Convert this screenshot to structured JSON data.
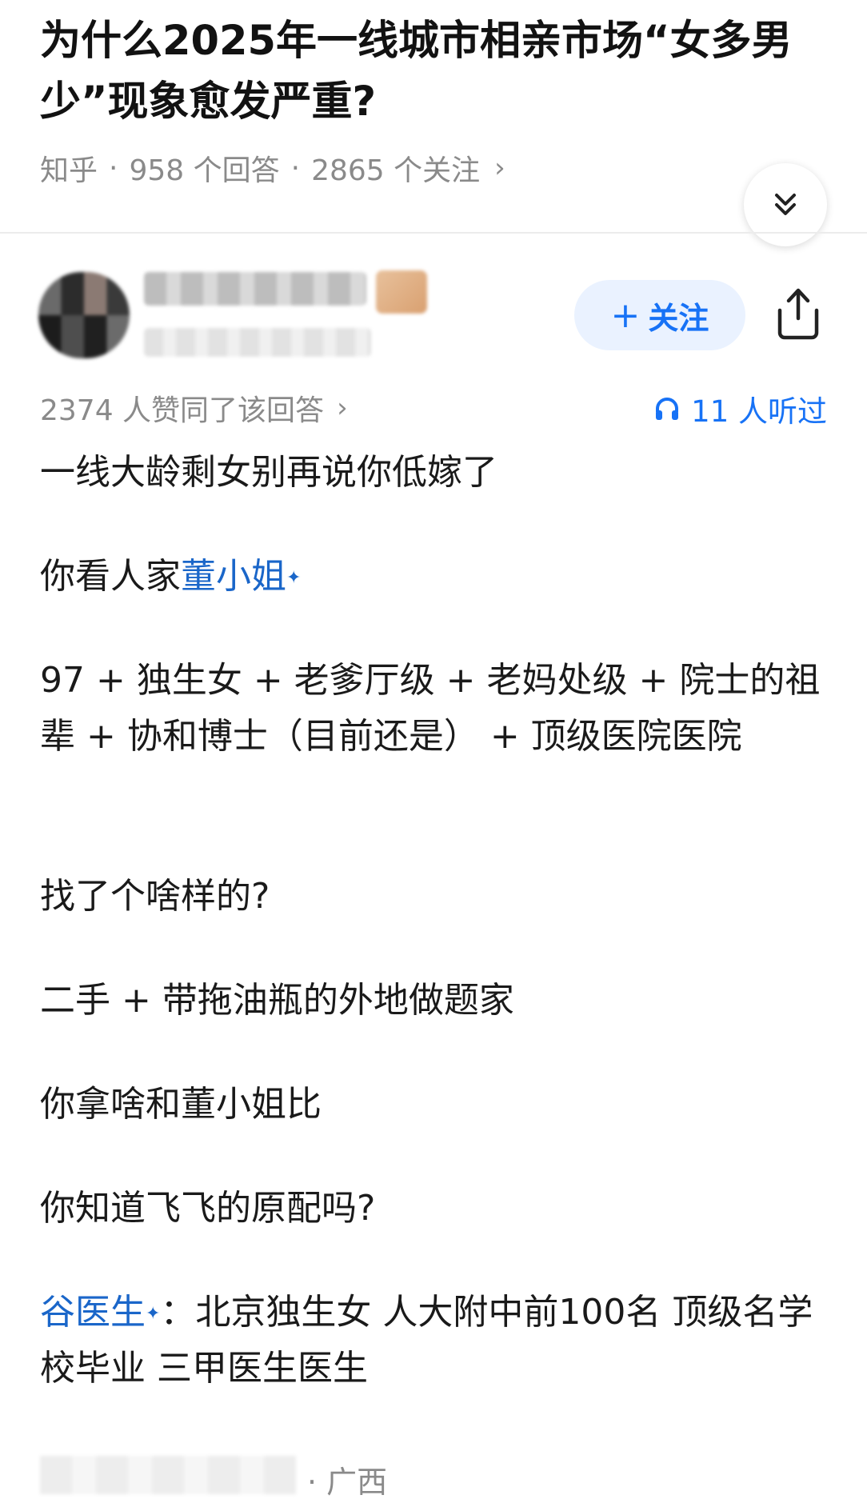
{
  "question": {
    "title": "为什么2025年一线城市相亲市场“女多男少”现象愈发严重?",
    "source": "知乎",
    "answers": "958 个回答",
    "followers": "2865 个关注"
  },
  "author": {
    "follow_label": "关注"
  },
  "stats": {
    "likes": "2374 人赞同了该回答",
    "listens": "11 人听过"
  },
  "body": {
    "p1": "一线大龄剩女别再说你低嫁了",
    "p2_prefix": "你看人家",
    "p2_link": "董小姐",
    "p3": "97 + 独生女 + 老爹厅级 + 老妈处级 + 院士的祖辈 + 协和博士（目前还是） + 顶级医院医院",
    "p4": "找了个啥样的?",
    "p5": "二手 + 带拖油瓶的外地做题家",
    "p6": "你拿啥和董小姐比",
    "p7": "你知道飞飞的原配吗?",
    "p8_link": "谷医生",
    "p8_rest": "：北京独生女 人大附中前100名 顶级名学校毕业 三甲医生医生",
    "link_marker": "✦"
  },
  "footer": {
    "location": "· 广西"
  },
  "colors": {
    "accent": "#1772f6",
    "link": "#1a66c9",
    "muted": "#8a8a8a"
  }
}
